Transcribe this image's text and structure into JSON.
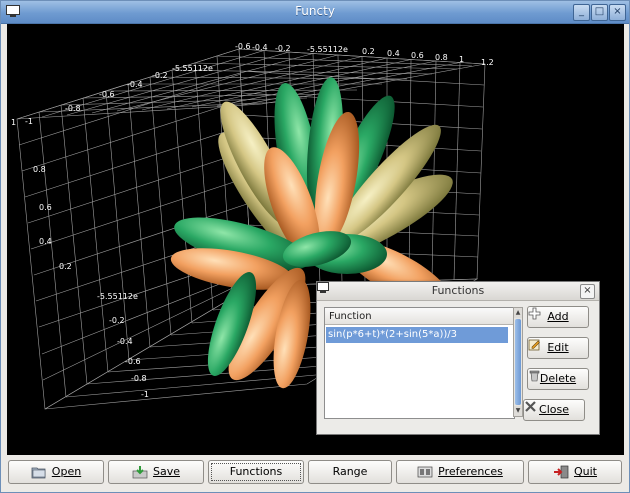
{
  "window": {
    "title": "Functy",
    "controls": [
      "minimize-icon",
      "maximize-icon",
      "close-icon"
    ]
  },
  "viewport": {
    "axis_labels": {
      "top_row": [
        "-0.6",
        "-0.4",
        "-0.2",
        "-5.55112e",
        "0.2",
        "0.4",
        "0.6",
        "0.8",
        "1",
        "1.2"
      ],
      "left_top_row": [
        "-1",
        "-0.8",
        "-0.6",
        "-0.4",
        "-0.2",
        "-5.55112e"
      ],
      "left_column": [
        "1",
        "0.8",
        "0.6",
        "0.4",
        "0.2",
        "-5.55112e",
        "-0.2",
        "-0.4",
        "-0.6",
        "-0.8",
        "-1"
      ],
      "corner_top_left": "1"
    }
  },
  "dialog": {
    "title": "Functions",
    "column_header": "Function",
    "functions": [
      "sin(p*6+t)*(2+sin(5*a))/3"
    ],
    "buttons": {
      "add": "Add",
      "edit": "Edit",
      "delete": "Delete",
      "close": "Close"
    }
  },
  "toolbar": {
    "open": "Open",
    "save": "Save",
    "functions": "Functions",
    "range": "Range",
    "preferences": "Preferences",
    "quit": "Quit"
  },
  "colors": {
    "titlebar": "#6f9bd1",
    "selection": "#6f9bd8",
    "petal_green": "#2fa86a",
    "petal_orange": "#f2a060",
    "petal_tan": "#d9c98e"
  }
}
